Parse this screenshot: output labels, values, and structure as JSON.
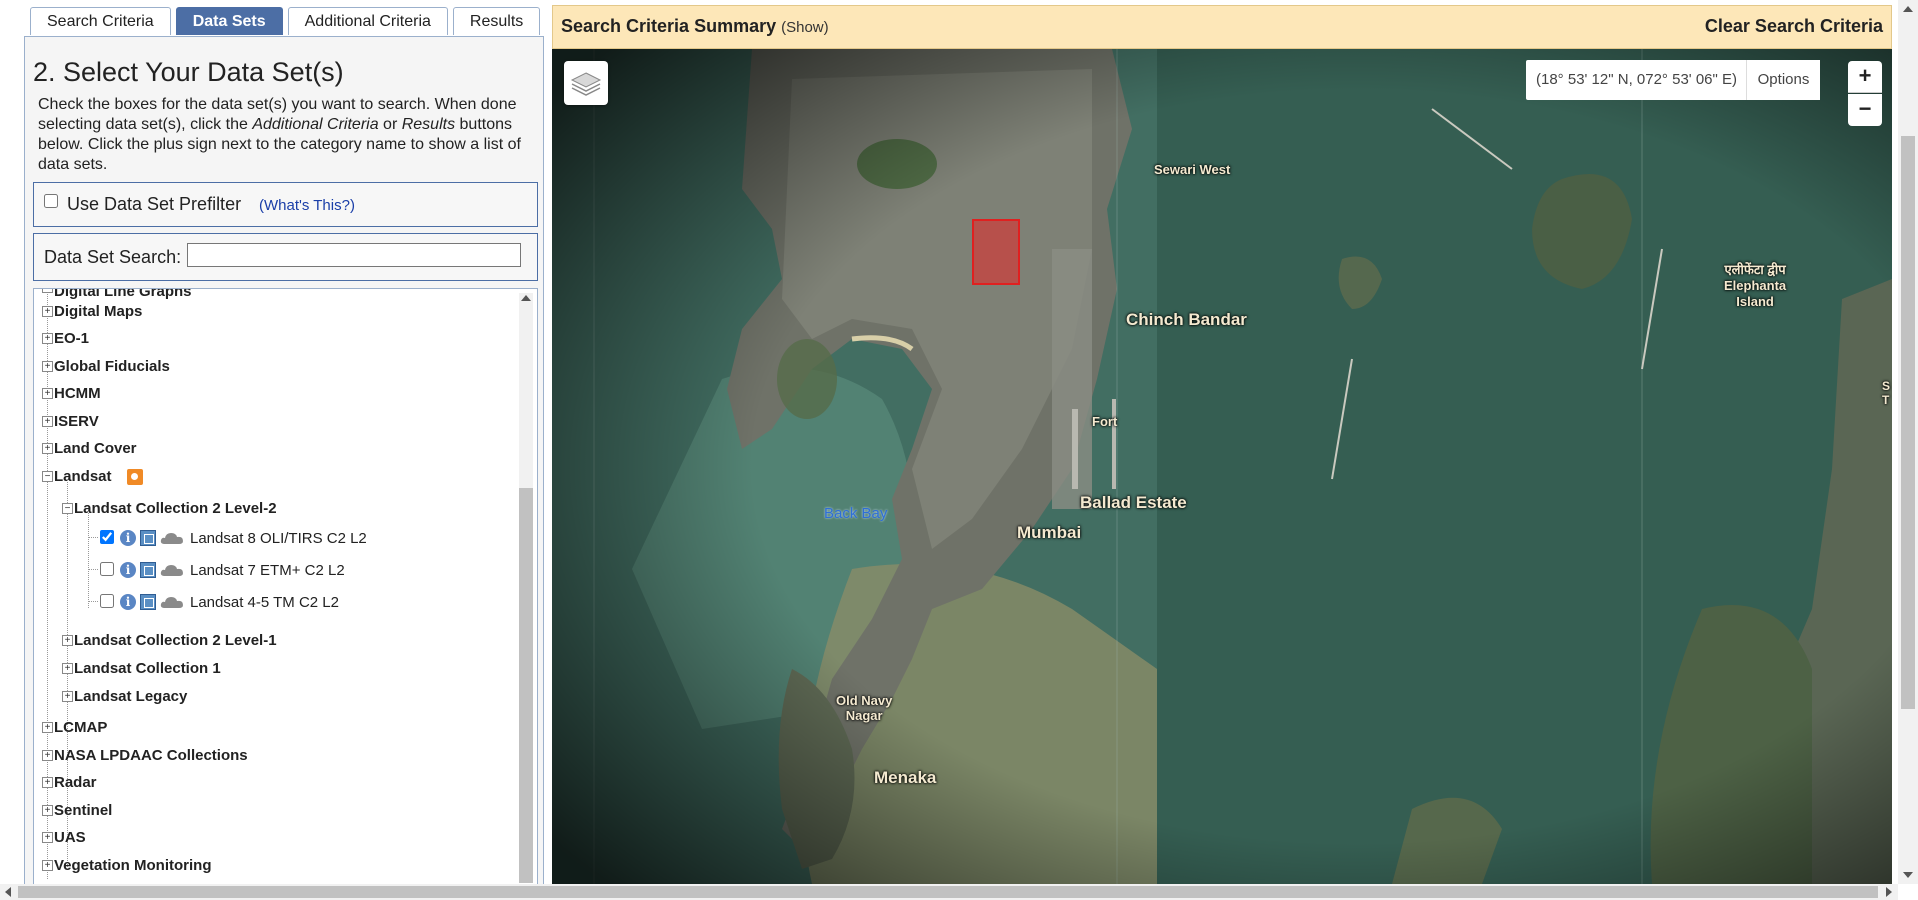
{
  "tabs": [
    {
      "label": "Search Criteria",
      "active": false
    },
    {
      "label": "Data Sets",
      "active": true
    },
    {
      "label": "Additional Criteria",
      "active": false
    },
    {
      "label": "Results",
      "active": false
    }
  ],
  "panel": {
    "heading": "2. Select Your Data Set(s)",
    "instr_1": "Check the boxes for the data set(s) you want to search. When done selecting data set(s), click the ",
    "instr_em1": "Additional Criteria",
    "instr_2": " or ",
    "instr_em2": "Results",
    "instr_3": " buttons below. Click the plus sign next to the category name to show a list of data sets.",
    "prefilter_label": "Use Data Set Prefilter",
    "prefilter_help": "(What's This?)",
    "search_label": "Data Set Search:",
    "search_value": ""
  },
  "tree": {
    "partial_top": "Digital Line Graphs",
    "categories_top": [
      "Digital Maps",
      "EO-1",
      "Global Fiducials",
      "HCMM",
      "ISERV",
      "Land Cover"
    ],
    "landsat": {
      "label": "Landsat",
      "icon": "landsat-logo-icon",
      "collection_open": "Landsat Collection 2 Level-2",
      "datasets": [
        {
          "label": "Landsat 8 OLI/TIRS C2 L2",
          "checked": true
        },
        {
          "label": "Landsat 7 ETM+ C2 L2",
          "checked": false
        },
        {
          "label": "Landsat 4-5 TM C2 L2",
          "checked": false
        }
      ],
      "collections_closed": [
        "Landsat Collection 2 Level-1",
        "Landsat Collection 1",
        "Landsat Legacy"
      ]
    },
    "categories_bottom": [
      "LCMAP",
      "NASA LPDAAC Collections",
      "Radar",
      "Sentinel",
      "UAS",
      "Vegetation Monitoring"
    ],
    "expand_glyph": "+",
    "collapse_glyph": "−",
    "info_glyph": "i"
  },
  "summary": {
    "title": "Search Criteria Summary",
    "show": "(Show)",
    "clear": "Clear Search Criteria"
  },
  "map": {
    "coords": "(18° 53' 12\" N, 072° 53' 06\" E)",
    "options": "Options",
    "zoom_in": "+",
    "zoom_out": "−",
    "labels": {
      "sewari": "Sewari West",
      "chinch": "Chinch Bandar",
      "fort": "Fort",
      "ballad": "Ballad Estate",
      "mumbai": "Mumbai",
      "backbay": "Back Bay",
      "oldnavy_1": "Old Navy",
      "oldnavy_2": "Nagar",
      "menaka": "Menaka",
      "elephanta_1": "एलीफेंटा द्वीप",
      "elephanta_2": "Elephanta",
      "elephanta_3": "Island",
      "edge_1": "S",
      "edge_2": "T"
    }
  },
  "colors": {
    "tab_active": "#4c6ea5",
    "summary_bg": "#fde7b8",
    "aoi": "#e02020",
    "link": "#1a3ea8"
  }
}
